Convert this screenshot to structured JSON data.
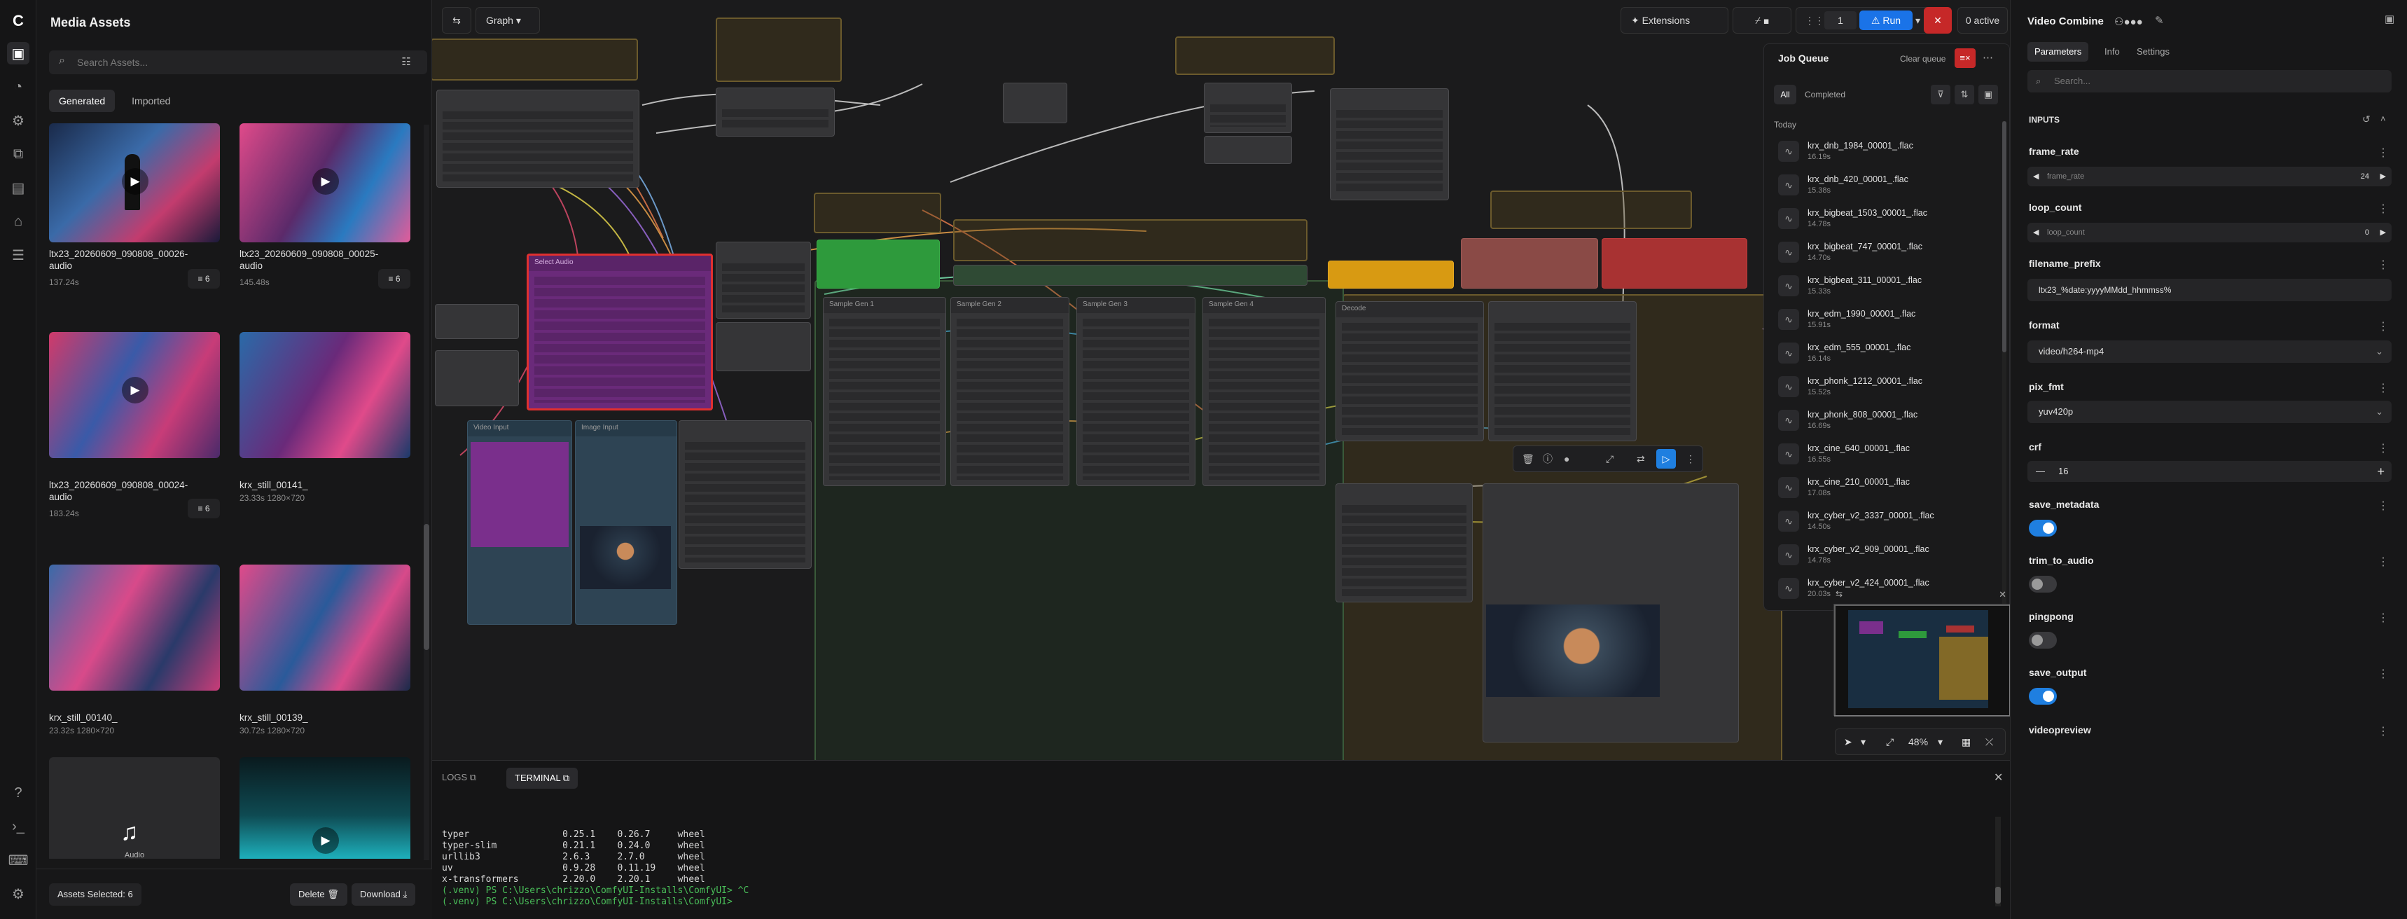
{
  "sidebar": {
    "brand": "C"
  },
  "assets": {
    "title": "Media Assets",
    "search_placeholder": "Search Assets...",
    "tabs": [
      "Generated",
      "Imported"
    ],
    "items": [
      {
        "name": "ltx23_20260609_090808_00026-audio",
        "meta": "137.24s",
        "count": "6"
      },
      {
        "name": "ltx23_20260609_090808_00025-audio",
        "meta": "145.48s",
        "count": "6"
      },
      {
        "name": "ltx23_20260609_090808_00024-audio",
        "meta": "183.24s",
        "count": "6"
      },
      {
        "name": "krx_still_00141_",
        "meta": "23.33s 1280×720",
        "count": ""
      },
      {
        "name": "krx_still_00140_",
        "meta": "23.32s 1280×720",
        "count": ""
      },
      {
        "name": "krx_still_00139_",
        "meta": "30.72s 1280×720",
        "count": ""
      }
    ],
    "audio_label": "Audio",
    "selected": "Assets Selected: 6",
    "delete_label": "Delete",
    "download_label": "Download"
  },
  "canvas": {
    "mode_label": "Graph",
    "extensions_label": "Extensions",
    "run_count": "1",
    "run_label": "Run",
    "active_label": "0 active",
    "zoom": "48%",
    "node_titles": [
      "Select Audio",
      "Video Input",
      "Image Input",
      "Sample Gen 1",
      "Sample Gen 2",
      "Sample Gen 3",
      "Sample Gen 4",
      "Decode"
    ]
  },
  "job_queue": {
    "title": "Job Queue",
    "clear_label": "Clear queue",
    "filters": [
      "All",
      "Completed"
    ],
    "section": "Today",
    "jobs": [
      {
        "name": "krx_dnb_1984_00001_.flac",
        "duration": "16.19s"
      },
      {
        "name": "krx_dnb_420_00001_.flac",
        "duration": "15.38s"
      },
      {
        "name": "krx_bigbeat_1503_00001_.flac",
        "duration": "14.78s"
      },
      {
        "name": "krx_bigbeat_747_00001_.flac",
        "duration": "14.70s"
      },
      {
        "name": "krx_bigbeat_311_00001_.flac",
        "duration": "15.33s"
      },
      {
        "name": "krx_edm_1990_00001_.flac",
        "duration": "15.91s"
      },
      {
        "name": "krx_edm_555_00001_.flac",
        "duration": "16.14s"
      },
      {
        "name": "krx_phonk_1212_00001_.flac",
        "duration": "15.52s"
      },
      {
        "name": "krx_phonk_808_00001_.flac",
        "duration": "16.69s"
      },
      {
        "name": "krx_cine_640_00001_.flac",
        "duration": "16.55s"
      },
      {
        "name": "krx_cine_210_00001_.flac",
        "duration": "17.08s"
      },
      {
        "name": "krx_cyber_v2_3337_00001_.flac",
        "duration": "14.50s"
      },
      {
        "name": "krx_cyber_v2_909_00001_.flac",
        "duration": "14.78s"
      },
      {
        "name": "krx_cyber_v2_424_00001_.flac",
        "duration": "20.03s"
      }
    ]
  },
  "bottom_panel": {
    "tabs": [
      "LOGS",
      "TERMINAL"
    ],
    "lines": [
      "typer                 0.25.1    0.26.7     wheel",
      "typer-slim            0.21.1    0.24.0     wheel",
      "urllib3               2.6.3     2.7.0      wheel",
      "uv                    0.9.28    0.11.19    wheel",
      "x-transformers        2.20.0    2.20.1     wheel",
      "(.venv) PS C:\\Users\\chrizzo\\ComfyUI-Installs\\ComfyUI> ^C",
      "(.venv) PS C:\\Users\\chrizzo\\ComfyUI-Installs\\ComfyUI> "
    ]
  },
  "properties": {
    "title": "Video Combine",
    "tabs": [
      "Parameters",
      "Info",
      "Settings"
    ],
    "search_placeholder": "Search...",
    "section": "INPUTS",
    "frame_rate": {
      "label": "frame_rate",
      "sub": "frame_rate",
      "value": "24"
    },
    "loop_count": {
      "label": "loop_count",
      "sub": "loop_count",
      "value": "0"
    },
    "filename_prefix": {
      "label": "filename_prefix",
      "value": "ltx23_%date:yyyyMMdd_hhmmss%"
    },
    "format": {
      "label": "format",
      "value": "video/h264-mp4"
    },
    "pix_fmt": {
      "label": "pix_fmt",
      "value": "yuv420p"
    },
    "crf": {
      "label": "crf",
      "value": "16"
    },
    "save_metadata": {
      "label": "save_metadata",
      "on": true
    },
    "trim_to_audio": {
      "label": "trim_to_audio",
      "on": false
    },
    "pingpong": {
      "label": "pingpong",
      "on": false
    },
    "save_output": {
      "label": "save_output",
      "on": true
    },
    "videopreview": {
      "label": "videopreview"
    }
  },
  "colors": {
    "accent": "#1f7fe0",
    "run": "#1a73e8",
    "stop": "#c62828",
    "green_node": "#2e9a3c",
    "purple_node": "#7a2f8c",
    "yellow_node": "#d89a12",
    "red_node": "#a83232"
  }
}
